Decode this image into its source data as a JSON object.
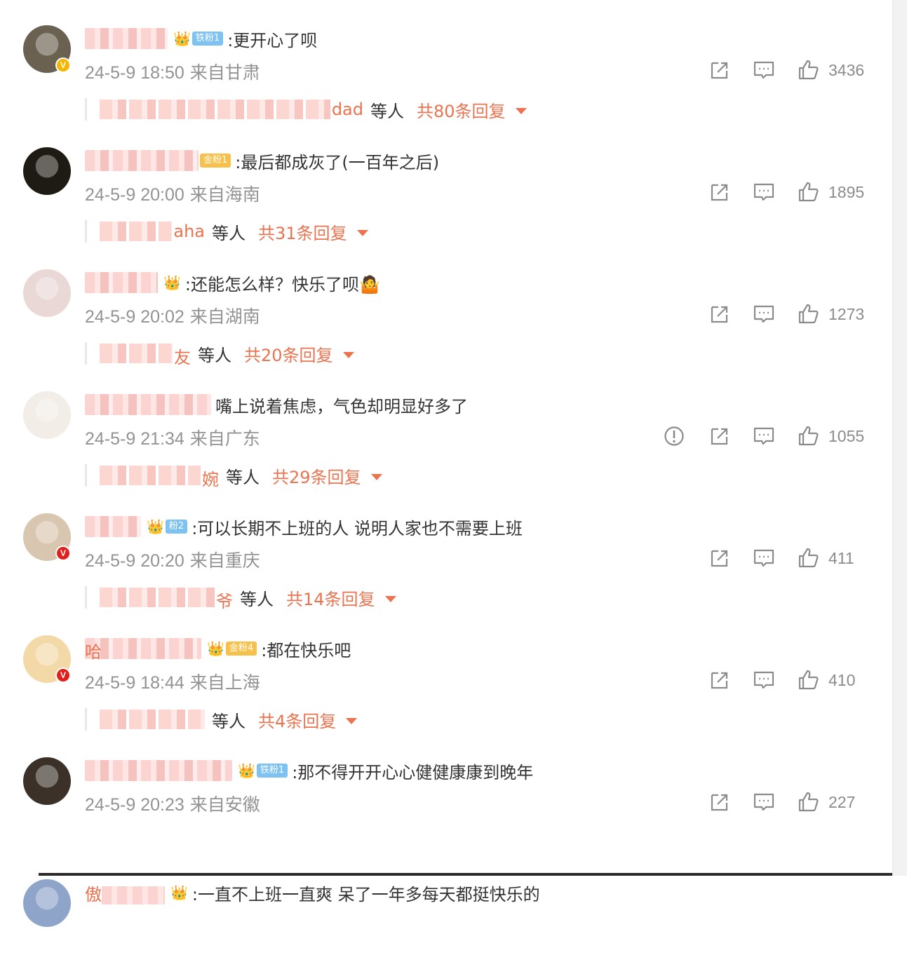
{
  "comments": [
    {
      "username_tail": "",
      "badge_icon": "👑",
      "badge_label": "铁粉1",
      "badge_type": "iron",
      "text": ":更开心了呗",
      "time": "24-5-9 18:50",
      "place": "来自甘肃",
      "likes": "3436",
      "reply_names_tail": "dad",
      "reply_etc": "等人",
      "reply_count": "共80条回复",
      "verified": "gold",
      "avatar_color": "#6b6150"
    },
    {
      "username_tail": "",
      "badge_icon": "",
      "badge_label": "金粉1",
      "badge_type": "gold",
      "text": ":最后都成灰了(一百年之后)",
      "time": "24-5-9 20:00",
      "place": "来自海南",
      "likes": "1895",
      "reply_names_tail": "aha",
      "reply_etc": "等人",
      "reply_count": "共31条回复",
      "verified": "",
      "avatar_color": "#1e1a14"
    },
    {
      "username_tail": "",
      "badge_icon": "👑",
      "badge_label": "",
      "badge_type": "",
      "text": ":还能怎么样？快乐了呗🤷",
      "time": "24-5-9 20:02",
      "place": "来自湖南",
      "likes": "1273",
      "reply_names_tail": "友",
      "reply_etc": "等人",
      "reply_count": "共20条回复",
      "verified": "",
      "avatar_color": "#e9d8d6"
    },
    {
      "username_tail": "",
      "badge_icon": "",
      "badge_label": "",
      "badge_type": "",
      "text": "嘴上说着焦虑，气色却明显好多了",
      "time": "24-5-9 21:34",
      "place": "来自广东",
      "likes": "1055",
      "reply_names_tail": "婉",
      "reply_etc": "等人",
      "reply_count": "共29条回复",
      "verified": "",
      "avatar_color": "#f2ede6",
      "has_report": true
    },
    {
      "username_tail": "",
      "badge_icon": "👑",
      "badge_label": "粉2",
      "badge_type": "iron",
      "text": ":可以长期不上班的人 说明人家也不需要上班",
      "time": "24-5-9 20:20",
      "place": "来自重庆",
      "likes": "411",
      "reply_names_tail": "爷",
      "reply_etc": "等人",
      "reply_count": "共14条回复",
      "verified": "red",
      "avatar_color": "#d9c6b0"
    },
    {
      "username_tail": "哈",
      "badge_icon": "👑",
      "badge_label": "金粉4",
      "badge_type": "gold",
      "text": ":都在快乐吧",
      "time": "24-5-9 18:44",
      "place": "来自上海",
      "likes": "410",
      "reply_names_tail": "",
      "reply_etc": "等人",
      "reply_count": "共4条回复",
      "verified": "red",
      "avatar_color": "#f3d9a8"
    },
    {
      "username_tail": "",
      "badge_icon": "👑",
      "badge_label": "铁粉1",
      "badge_type": "iron",
      "text": ":那不得开开心心健健康康到晚年",
      "time": "24-5-9 20:23",
      "place": "来自安徽",
      "likes": "227",
      "reply_names_tail": "",
      "reply_etc": "",
      "reply_count": "",
      "verified": "",
      "avatar_color": "#3b3128"
    },
    {
      "username_tail": "",
      "username_head": "傲",
      "badge_icon": "👑",
      "badge_label": "",
      "badge_type": "",
      "text": ":一直不上班一直爽 呆了一年多每天都挺快乐的",
      "time": "",
      "place": "",
      "likes": "",
      "reply_names_tail": "",
      "reply_etc": "",
      "reply_count": "",
      "verified": "",
      "avatar_color": "#8fa4c9"
    }
  ],
  "icons": {
    "share": "share-icon",
    "comment": "comment-icon",
    "like": "like-icon",
    "report": "report-icon",
    "caret": "caret-down-icon"
  },
  "colors": {
    "accent": "#eb7350",
    "meta": "#939393"
  }
}
